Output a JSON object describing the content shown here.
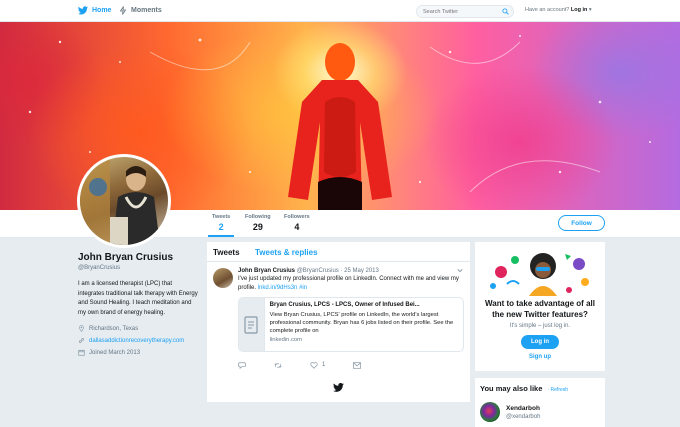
{
  "colors": {
    "accent": "#1da1f2",
    "background": "#e6ecf0",
    "text": "#14171a",
    "muted": "#657786"
  },
  "topnav": {
    "home_label": "Home",
    "moments_label": "Moments",
    "search_placeholder": "Search Twitter",
    "account_prompt": "Have an account?",
    "login_label": "Log in",
    "icons": [
      "twitter-bird-icon",
      "bolt-icon",
      "search-icon",
      "caret-down-icon"
    ]
  },
  "profile_nav": {
    "stats": [
      {
        "label": "Tweets",
        "value": "2"
      },
      {
        "label": "Following",
        "value": "29"
      },
      {
        "label": "Followers",
        "value": "4"
      }
    ],
    "follow_label": "Follow"
  },
  "profile": {
    "name": "John Bryan Crusius",
    "handle": "@BryanCrusius",
    "bio": "I am a licensed therapist (LPC) that integrates traditional talk therapy with Energy and Sound Healing. I teach meditation and my own brand of energy healing.",
    "location": "Richardson, Texas",
    "website": "dallasaddictionrecoverytherapy.com",
    "joined": "Joined March 2013"
  },
  "timeline": {
    "tabs": [
      "Tweets",
      "Tweets & replies"
    ],
    "tweets": [
      {
        "author": "John Bryan Crusius",
        "handle": "@BryanCrusius",
        "date": "25 May 2013",
        "text": "I've just updated my professional profile on LinkedIn. Connect with me and view my profile.",
        "link": "lnkd.in/9dHs3n",
        "hashtag": "#in",
        "card": {
          "title": "Bryan Crusius, LPCS - LPCS, Owner of Infused Bei...",
          "description": "View Bryan Crusius, LPCS' profile on LinkedIn, the world's largest professional community. Bryan has 6 jobs listed on their profile. See the complete profile on",
          "domain": "linkedin.com"
        },
        "likes": "1"
      }
    ]
  },
  "promo": {
    "title": "Want to take advantage of all the new Twitter features?",
    "subtitle": "It's simple – just log in.",
    "login_label": "Log in",
    "signup_label": "Sign up"
  },
  "also_like": {
    "title": "You may also like",
    "refresh_label": "· Refresh",
    "suggestions": [
      {
        "name": "Xendarboh",
        "handle": "@xendarboh"
      }
    ]
  }
}
